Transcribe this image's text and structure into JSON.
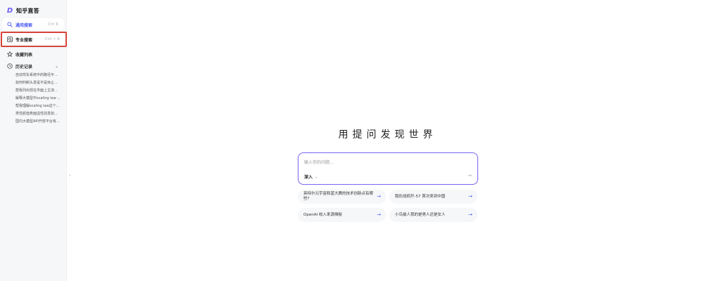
{
  "app": {
    "logo_mark": "D",
    "title": "知乎直答"
  },
  "sidebar": {
    "items": [
      {
        "label": "通用搜索",
        "shortcut": "Ctrl  K",
        "icon": "search-icon"
      },
      {
        "label": "专业搜索",
        "shortcut": "Ctrl  ⇧  K",
        "icon": "pro-search-icon"
      },
      {
        "label": "收藏列表",
        "icon": "star-icon"
      },
      {
        "label": "历史记录",
        "icon": "history-icon"
      }
    ],
    "history": [
      "自动驾车系统中的路径平...",
      "如何判断头发是不是休止...",
      "帮我列出现在市面上主流...",
      "解释大模型中scaling law ...",
      "帮我理解scaling law这个...",
      "男性颜值表面溢性前发如...",
      "国内大模型API开放平台有..."
    ],
    "collapse_icon": "‹"
  },
  "main": {
    "heading": "用提问发现世界",
    "input": {
      "placeholder": "输入你的问题...",
      "mode": "深入",
      "send_icon": "→"
    },
    "suggestions": [
      "英特尔元宇宙和蓝大赛的技术创新点有哪些?",
      "隐形战机歼-57 首次来到中国",
      "OpenAI 收入来源揭秘",
      "小鸟偷人我的是男人还是女人"
    ]
  },
  "colors": {
    "accent": "#4e5bf2",
    "highlight_frame": "#d6453a",
    "input_border": "#7c6cf2"
  }
}
